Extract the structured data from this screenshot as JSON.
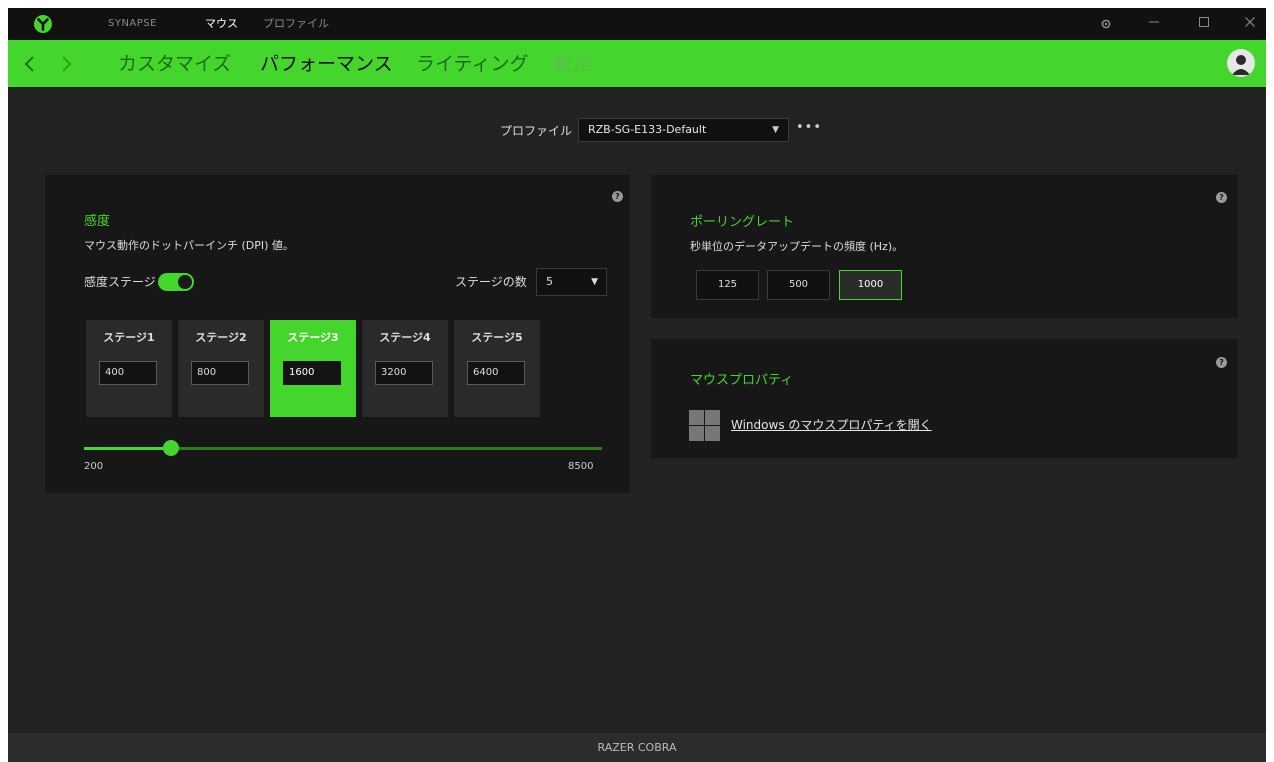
{
  "titlebar": {
    "app_name": "SYNAPSE",
    "device_tab": "マウス",
    "profile_tab": "プロファイル",
    "logo_icon": "razer-logo-icon",
    "buttons": [
      "settings-icon",
      "minimize-icon",
      "maximize-icon",
      "close-icon"
    ]
  },
  "nav": {
    "tabs": [
      "カスタマイズ",
      "パフォーマンス",
      "ライティング",
      "較正"
    ],
    "active_tab": "パフォーマンス"
  },
  "profile": {
    "label": "プロファイル",
    "selected": "RZB-SG-E133-Default",
    "more": "•••"
  },
  "sensitivity": {
    "title": "感度",
    "description": "マウス動作のドットパーインチ (DPI) 値。",
    "stages_toggle_label": "感度ステージ",
    "stages_enabled": true,
    "stage_count_label": "ステージの数",
    "stage_count": "5",
    "stages": [
      {
        "label": "ステージ1",
        "dpi": "400"
      },
      {
        "label": "ステージ2",
        "dpi": "800"
      },
      {
        "label": "ステージ3",
        "dpi": "1600"
      },
      {
        "label": "ステージ4",
        "dpi": "3200"
      },
      {
        "label": "ステージ5",
        "dpi": "6400"
      }
    ],
    "active_stage": 3,
    "slider": {
      "min": "200",
      "max": "8500",
      "value": 1600
    }
  },
  "polling": {
    "title": "ポーリングレート",
    "description": "秒単位のデータアップデートの頻度 (Hz)。",
    "options": [
      "125",
      "500",
      "1000"
    ],
    "selected": "1000"
  },
  "mouse_properties": {
    "title": "マウスプロパティ",
    "link": "Windows のマウスプロパティを開く",
    "icon": "windows-logo-icon"
  },
  "footer": {
    "device_name": "RAZER COBRA"
  },
  "colors": {
    "accent": "#44d62c",
    "background": "#222222",
    "panel": "#171717"
  }
}
